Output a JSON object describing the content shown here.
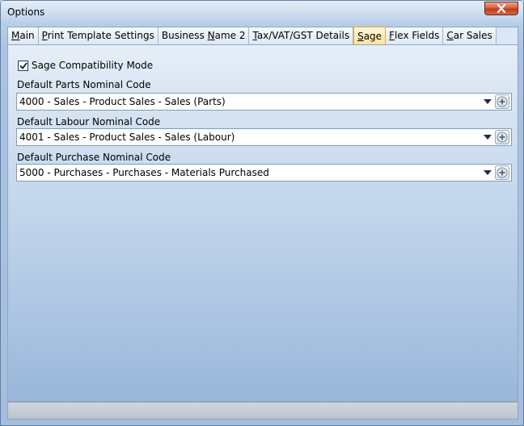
{
  "window": {
    "title": "Options",
    "close_label": "×"
  },
  "tabs": [
    {
      "label": "Main",
      "underline": "M",
      "active": false
    },
    {
      "label": "Print Template Settings",
      "underline": "P",
      "active": false
    },
    {
      "label": "Business Name 2",
      "underline": "N",
      "active": false
    },
    {
      "label": "Tax/VAT/GST Details",
      "underline": "T",
      "active": false
    },
    {
      "label": "Sage",
      "underline": "S",
      "active": true
    },
    {
      "label": "Flex Fields",
      "underline": "F",
      "active": false
    },
    {
      "label": "Car Sales",
      "underline": "C",
      "active": false
    }
  ],
  "sage": {
    "compat_label": "Sage Compatibility Mode",
    "compat_checked": true,
    "parts_label": "Default Parts Nominal Code",
    "parts_value": "4000 - Sales - Product Sales - Sales (Parts)",
    "labour_label": "Default Labour Nominal Code",
    "labour_value": "4001 - Sales - Product Sales - Sales (Labour)",
    "purchase_label": "Default Purchase Nominal Code",
    "purchase_value": "5000 - Purchases - Purchases - Materials Purchased"
  },
  "icons": {
    "close": "close-icon",
    "checkbox": "checkmark-icon",
    "dropdown": "dropdown-arrow-icon",
    "add": "plus-circle-icon"
  },
  "colors": {
    "active_tab": "#ffe39a",
    "panel_top": "#e6eef8",
    "panel_bottom": "#98b6da",
    "close_button": "#c23b16"
  }
}
